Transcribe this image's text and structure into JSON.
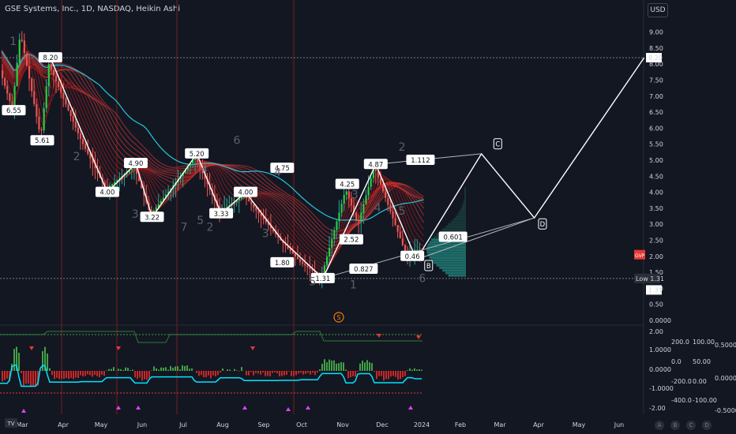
{
  "header": {
    "title": "GSE Systems, Inc., 1D, NASDAQ, Heikin Ashi",
    "currency": "USD"
  },
  "price_axis": {
    "ticks": [
      "9.00",
      "8.50",
      "8.00",
      "7.50",
      "7.00",
      "6.50",
      "6.00",
      "5.50",
      "5.00",
      "4.50",
      "4.00",
      "3.50",
      "3.00",
      "2.50",
      "2.00",
      "1.50",
      "1.00",
      "0.50",
      "0.0000"
    ],
    "last_price": "8.20",
    "gvp_label": "GVP",
    "low_label": "Low",
    "low_value": "1.31",
    "low_price": "1.31"
  },
  "osc_axis_left": [
    "2.00",
    "1.0000",
    "0.0000",
    "-1.0000",
    "-2.00"
  ],
  "osc_axis_mid": [
    "200.0",
    "0.0",
    "-200.0",
    "-400.0"
  ],
  "osc_axis_right": [
    "100.00",
    "50.00",
    "0.00",
    "-100.00",
    "-200.00"
  ],
  "osc_axis_far": [
    "0.5000",
    "0.0000",
    "-0.5000"
  ],
  "time_axis": [
    "Mar",
    "Apr",
    "May",
    "Jun",
    "Jul",
    "Aug",
    "Sep",
    "Oct",
    "Nov",
    "Dec",
    "2024",
    "Feb",
    "Mar",
    "Apr",
    "May",
    "Jun"
  ],
  "price_labels": [
    {
      "text": "8.20",
      "price": 8.2,
      "day": 60
    },
    {
      "text": "6.55",
      "price": 6.55,
      "day": 15
    },
    {
      "text": "5.61",
      "price": 5.61,
      "day": 50
    },
    {
      "text": "4.90",
      "price": 4.9,
      "day": 165
    },
    {
      "text": "5.20",
      "price": 5.2,
      "day": 240
    },
    {
      "text": "4.75",
      "price": 4.75,
      "day": 345
    },
    {
      "text": "4.00",
      "price": 4.0,
      "day": 130
    },
    {
      "text": "3.22",
      "price": 3.22,
      "day": 185
    },
    {
      "text": "3.33",
      "price": 3.33,
      "day": 270
    },
    {
      "text": "4.00",
      "price": 4.0,
      "day": 300
    },
    {
      "text": "1.80",
      "price": 1.8,
      "day": 345
    },
    {
      "text": "1.31",
      "price": 1.31,
      "day": 395
    },
    {
      "text": "4.25",
      "price": 4.25,
      "day": 425
    },
    {
      "text": "4.87",
      "price": 4.87,
      "day": 460
    },
    {
      "text": "2.52",
      "price": 2.52,
      "day": 430
    },
    {
      "text": "0.827",
      "price": 0.827,
      "day": 445
    },
    {
      "text": "0.46",
      "price": 0.46,
      "day": 505
    },
    {
      "text": "0.601",
      "price": 0.601,
      "day": 555
    },
    {
      "text": "1.112",
      "price": 1.112,
      "day": 515
    }
  ],
  "wave_labels": [
    "B",
    "C",
    "D"
  ],
  "wave_numbers": [
    "1",
    "2",
    "3",
    "4",
    "5",
    "6",
    "7",
    "2",
    "3",
    "4",
    "5",
    "1",
    "2",
    "3",
    "4",
    "5",
    "6"
  ],
  "symbols": {
    "event_icon": "S",
    "tv_logo": "TV"
  },
  "scale_buttons": [
    "A",
    "B",
    "C",
    "D"
  ],
  "colors": {
    "bg": "#131722",
    "up": "#26a69a",
    "down": "#ef5350",
    "ribbon_up": "#4caf50",
    "ribbon_down": "#b71c1c",
    "ma": "#26c6da",
    "cyan": "#00e5ff"
  }
}
